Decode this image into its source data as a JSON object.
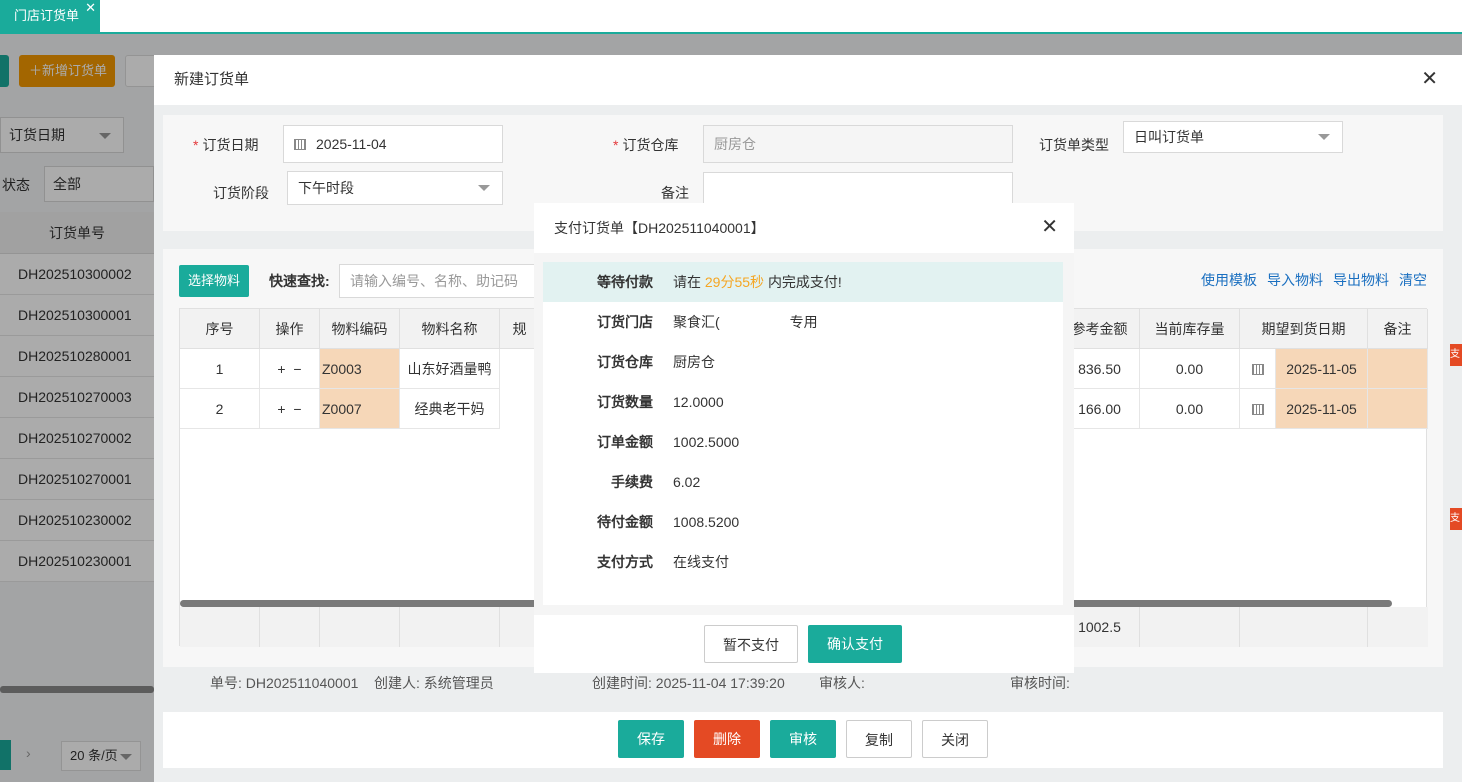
{
  "tabbar": {
    "tab_label": "门店订货单",
    "tab_close": "✕"
  },
  "background": {
    "add_button": "＋新增订货单",
    "filter_date": "订货日期",
    "status_label": "状态",
    "status_value": "全部",
    "col_order_no": "订货单号",
    "rows": [
      "DH202510300002",
      "DH202510300001",
      "DH202510280001",
      "DH202510270003",
      "DH202510270002",
      "DH202510270001",
      "DH202510230002",
      "DH202510230001"
    ],
    "pager_arrow": "›",
    "page_size": "20 条/页"
  },
  "order_modal": {
    "title": "新建订货单",
    "close": "✕",
    "form": {
      "date_label": "订货日期",
      "date_value": "2025-11-04",
      "warehouse_label": "订货仓库",
      "warehouse_placeholder": "厨房仓",
      "type_label": "订货单类型",
      "type_value": "日叫订货单",
      "stage_label": "订货阶段",
      "stage_value": "下午时段",
      "remark_label": "备注"
    },
    "toolbar": {
      "select_button": "选择物料",
      "quick_search_label": "快速查找:",
      "quick_search_placeholder": "请输入编号、名称、助记码",
      "links": [
        "使用模板",
        "导入物料",
        "导出物料",
        "清空"
      ]
    },
    "table": {
      "headers": [
        "序号",
        "操作",
        "物料编码",
        "物料名称",
        "规",
        "参考金额",
        "当前库存量",
        "期望到货日期",
        "备注"
      ],
      "rows": [
        {
          "seq": "1",
          "code": "Z0003",
          "name": "山东好酒量鸭",
          "amount": "836.50",
          "stock": "0.00",
          "date": "2025-11-05"
        },
        {
          "seq": "2",
          "code": "Z0007",
          "name": "经典老干妈",
          "amount": "166.00",
          "stock": "0.00",
          "date": "2025-11-05"
        }
      ],
      "op_plus": "+",
      "op_minus": "−",
      "footer_total": "1002.5"
    },
    "meta": {
      "order_no": "单号: DH202511040001",
      "creator": "创建人: 系统管理员",
      "created_time": "创建时间: 2025-11-04 17:39:20",
      "reviewer": "审核人:",
      "review_time": "审核时间:"
    },
    "buttons": {
      "save": "保存",
      "delete": "删除",
      "review": "审核",
      "copy": "复制",
      "close": "关闭"
    },
    "right_edge_text": "支"
  },
  "payment_dialog": {
    "title": "支付订货单【DH202511040001】",
    "close": "✕",
    "rows": {
      "wait_label": "等待付款",
      "wait_prefix": "请在",
      "countdown": "29分55秒",
      "wait_suffix": "内完成支付!",
      "store_label": "订货门店",
      "store_prefix": "聚食汇(",
      "store_suffix": "专用",
      "warehouse_label": "订货仓库",
      "warehouse_value": "厨房仓",
      "qty_label": "订货数量",
      "qty_value": "12.0000",
      "amount_label": "订单金额",
      "amount_value": "1002.5000",
      "fee_label": "手续费",
      "fee_value": "6.02",
      "due_label": "待付金额",
      "due_value": "1008.5200",
      "method_label": "支付方式",
      "method_value": "在线支付"
    },
    "buttons": {
      "later": "暂不支付",
      "confirm": "确认支付"
    }
  },
  "colors": {
    "accent": "#1aab9b",
    "orange": "#f39800",
    "danger": "#e44a24",
    "countdown": "#f5a623"
  }
}
